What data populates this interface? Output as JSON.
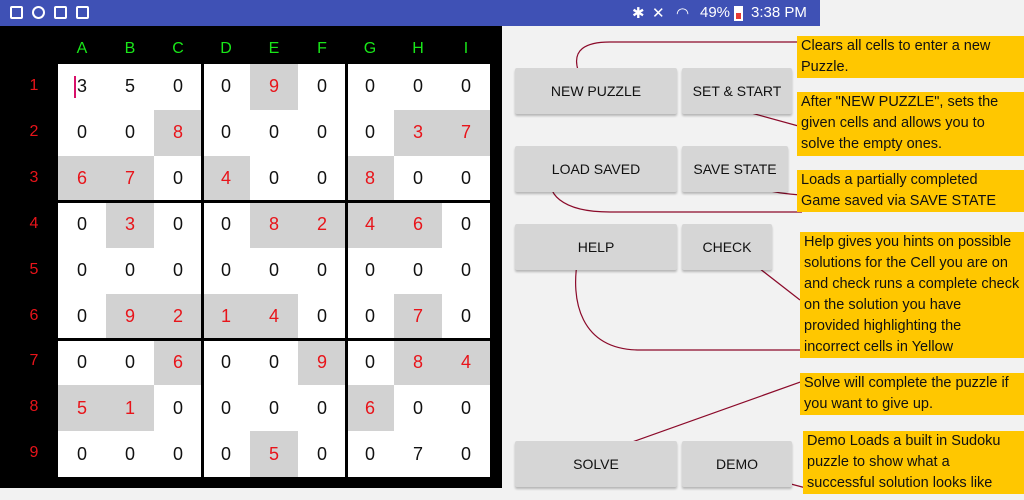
{
  "status_bar": {
    "battery": "49%",
    "time": "3:38 PM"
  },
  "board": {
    "columns": [
      "A",
      "B",
      "C",
      "D",
      "E",
      "F",
      "G",
      "H",
      "I"
    ],
    "rows": [
      "1",
      "2",
      "3",
      "4",
      "5",
      "6",
      "7",
      "8",
      "9"
    ],
    "values": [
      [
        "3",
        "5",
        "0",
        "0",
        "9",
        "0",
        "0",
        "0",
        "0"
      ],
      [
        "0",
        "0",
        "8",
        "0",
        "0",
        "0",
        "0",
        "3",
        "7"
      ],
      [
        "6",
        "7",
        "0",
        "4",
        "0",
        "0",
        "8",
        "0",
        "0"
      ],
      [
        "0",
        "3",
        "0",
        "0",
        "8",
        "2",
        "4",
        "6",
        "0"
      ],
      [
        "0",
        "0",
        "0",
        "0",
        "0",
        "0",
        "0",
        "0",
        "0"
      ],
      [
        "0",
        "9",
        "2",
        "1",
        "4",
        "0",
        "0",
        "7",
        "0"
      ],
      [
        "0",
        "0",
        "6",
        "0",
        "0",
        "9",
        "0",
        "8",
        "4"
      ],
      [
        "5",
        "1",
        "0",
        "0",
        "0",
        "0",
        "6",
        "0",
        "0"
      ],
      [
        "0",
        "0",
        "0",
        "0",
        "5",
        "0",
        "0",
        "7",
        "0"
      ]
    ],
    "given": [
      [
        0,
        0,
        0,
        0,
        1,
        0,
        0,
        0,
        0
      ],
      [
        0,
        0,
        1,
        0,
        0,
        0,
        0,
        1,
        1
      ],
      [
        1,
        1,
        0,
        1,
        0,
        0,
        1,
        0,
        0
      ],
      [
        0,
        1,
        0,
        0,
        1,
        1,
        1,
        1,
        0
      ],
      [
        0,
        0,
        0,
        0,
        0,
        0,
        0,
        0,
        0
      ],
      [
        0,
        1,
        1,
        1,
        1,
        0,
        0,
        1,
        0
      ],
      [
        0,
        0,
        1,
        0,
        0,
        1,
        0,
        1,
        1
      ],
      [
        1,
        1,
        0,
        0,
        0,
        0,
        1,
        0,
        0
      ],
      [
        0,
        0,
        0,
        0,
        1,
        0,
        0,
        0,
        0
      ]
    ]
  },
  "buttons": {
    "new_puzzle": "NEW PUZZLE",
    "set_start": "SET & START",
    "load_saved": "LOAD SAVED",
    "save_state": "SAVE STATE",
    "help": "HELP",
    "check": "CHECK",
    "solve": "SOLVE",
    "demo": "DEMO"
  },
  "notes": {
    "new_puzzle": "Clears all cells to enter a new Puzzle.",
    "set_start": "After \"NEW PUZZLE\", sets the given cells and allows you to solve the empty ones.",
    "load_saved": "Loads a partially completed Game saved via SAVE STATE",
    "help_check": "Help gives you hints on possible solutions for the Cell you are on and check runs a complete check on the solution you have provided highlighting the incorrect cells in Yellow",
    "solve": "Solve will complete the puzzle if you want to give up.",
    "demo": "Demo Loads a built in Sudoku puzzle to show what a successful solution looks like"
  },
  "colors": {
    "status_bar": "#3f51b5",
    "column_header": "#19e619",
    "row_header": "#e8141a",
    "given_text": "#e8141a",
    "given_cell": "#d2d2d2",
    "note_bg": "#ffc700",
    "connector": "#8b0a2a"
  }
}
